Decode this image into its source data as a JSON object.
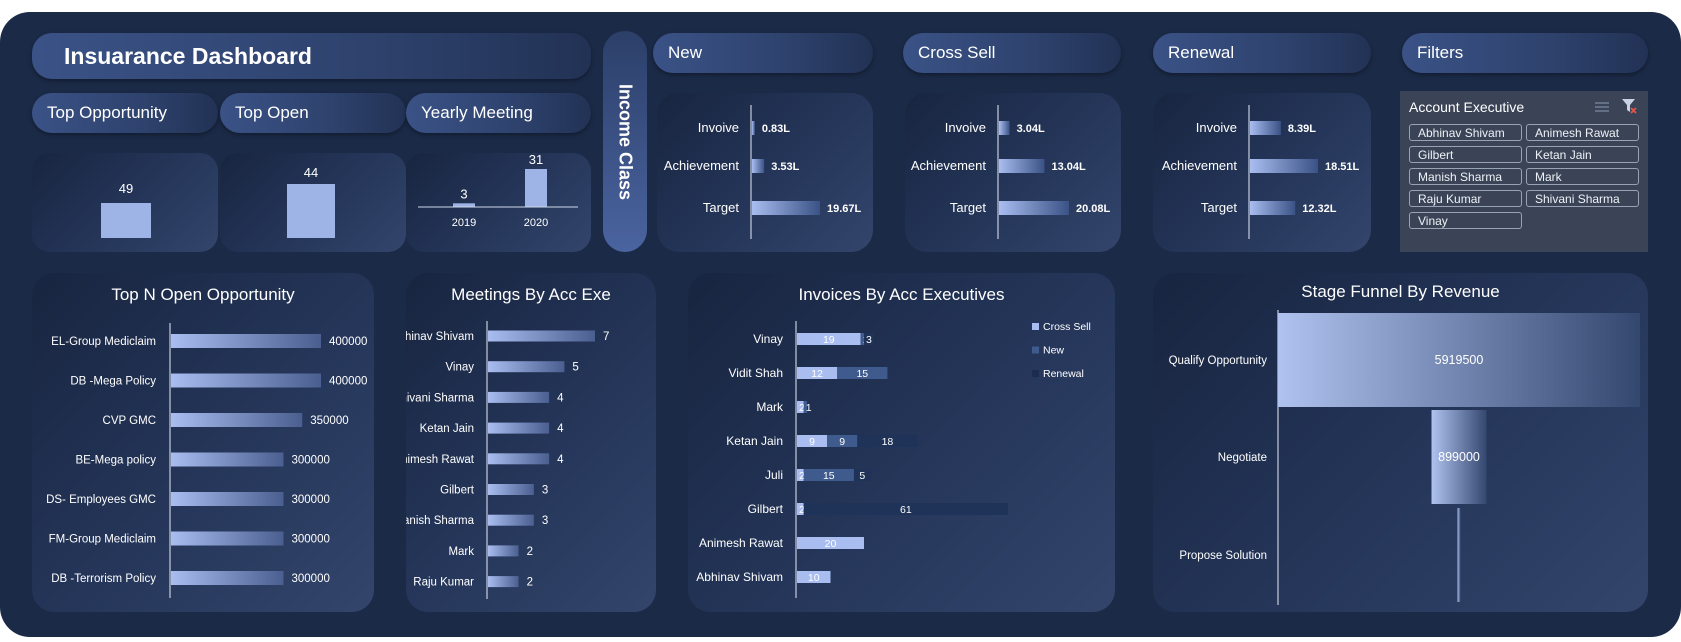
{
  "title": "Insuarance Dashboard",
  "income_class_label": "Income Class",
  "kpi_headers": [
    "Top Opportunity",
    "Top Open",
    "Yearly Meeting"
  ],
  "kpi_values": {
    "top_opportunity": "49",
    "top_open": "44"
  },
  "section_headers": {
    "new": "New",
    "cross_sell": "Cross Sell",
    "renewal": "Renewal",
    "filters": "Filters"
  },
  "filters": {
    "header": "Account Executive",
    "items": [
      "Abhinav Shivam",
      "Animesh Rawat",
      "Gilbert",
      "Ketan Jain",
      "Manish Sharma",
      "Mark",
      "Raju Kumar",
      "Shivani Sharma",
      "Vinay"
    ]
  },
  "panel_titles": {
    "top_n": "Top N Open Opportunity",
    "meetings": "Meetings By Acc Exe",
    "invoices": "Invoices By Acc Executives",
    "funnel": "Stage Funnel By Revenue"
  },
  "colors": {
    "bar_light": "#a9bdf0",
    "bar_mid": "#3f5a8c",
    "bar_dark": "#1f3257",
    "frame": "#1b2a47"
  },
  "chart_data": [
    {
      "id": "top_opportunity",
      "type": "bar",
      "categories": [
        ""
      ],
      "values": [
        49
      ]
    },
    {
      "id": "top_open",
      "type": "bar",
      "categories": [
        ""
      ],
      "values": [
        44
      ]
    },
    {
      "id": "yearly_meeting",
      "type": "bar",
      "categories": [
        "2019",
        "2020"
      ],
      "values": [
        3,
        31
      ]
    },
    {
      "id": "new",
      "type": "bar",
      "orientation": "horizontal",
      "categories": [
        "Invoive",
        "Achievement",
        "Target"
      ],
      "values": [
        0.83,
        3.53,
        19.67
      ],
      "labels": [
        "0.83L",
        "3.53L",
        "19.67L"
      ]
    },
    {
      "id": "cross_sell",
      "type": "bar",
      "orientation": "horizontal",
      "categories": [
        "Invoive",
        "Achievement",
        "Target"
      ],
      "values": [
        3.04,
        13.04,
        20.08
      ],
      "labels": [
        "3.04L",
        "13.04L",
        "20.08L"
      ]
    },
    {
      "id": "renewal",
      "type": "bar",
      "orientation": "horizontal",
      "categories": [
        "Invoive",
        "Achievement",
        "Target"
      ],
      "values": [
        8.39,
        18.51,
        12.32
      ],
      "labels": [
        "8.39L",
        "18.51L",
        "12.32L"
      ]
    },
    {
      "id": "top_n",
      "type": "bar",
      "orientation": "horizontal",
      "categories": [
        "EL-Group Mediclaim",
        "DB -Mega Policy",
        "CVP GMC",
        "BE-Mega policy",
        "DS- Employees GMC",
        "FM-Group Mediclaim",
        "DB -Terrorism Policy"
      ],
      "values": [
        400000,
        400000,
        350000,
        300000,
        300000,
        300000,
        300000
      ]
    },
    {
      "id": "meetings",
      "type": "bar",
      "orientation": "horizontal",
      "categories": [
        "Abhinav Shivam",
        "Vinay",
        "Shivani Sharma",
        "Ketan Jain",
        "Animesh Rawat",
        "Gilbert",
        "Manish Sharma",
        "Mark",
        "Raju Kumar"
      ],
      "values": [
        7,
        5,
        4,
        4,
        4,
        3,
        3,
        2,
        2
      ]
    },
    {
      "id": "invoices",
      "type": "bar",
      "orientation": "horizontal",
      "stacked": true,
      "categories": [
        "Vinay",
        "Vidit Shah",
        "Mark",
        "Ketan Jain",
        "Juli",
        "Gilbert",
        "Animesh Rawat",
        "Abhinav Shivam"
      ],
      "series": [
        {
          "name": "Cross Sell",
          "values": [
            19,
            12,
            2,
            9,
            2,
            2,
            20,
            10
          ]
        },
        {
          "name": "New",
          "values": [
            1,
            15,
            1,
            9,
            15,
            null,
            null,
            null
          ]
        },
        {
          "name": "Renewal",
          "values": [
            3,
            null,
            null,
            18,
            5,
            61,
            null,
            null
          ]
        }
      ]
    },
    {
      "id": "funnel",
      "type": "bar",
      "orientation": "funnel",
      "categories": [
        "Qualify Opportunity",
        "Negotiate",
        "Propose Solution"
      ],
      "values": [
        5919500,
        899000,
        30000
      ],
      "labels": [
        "5919500",
        "899000",
        ""
      ]
    }
  ]
}
